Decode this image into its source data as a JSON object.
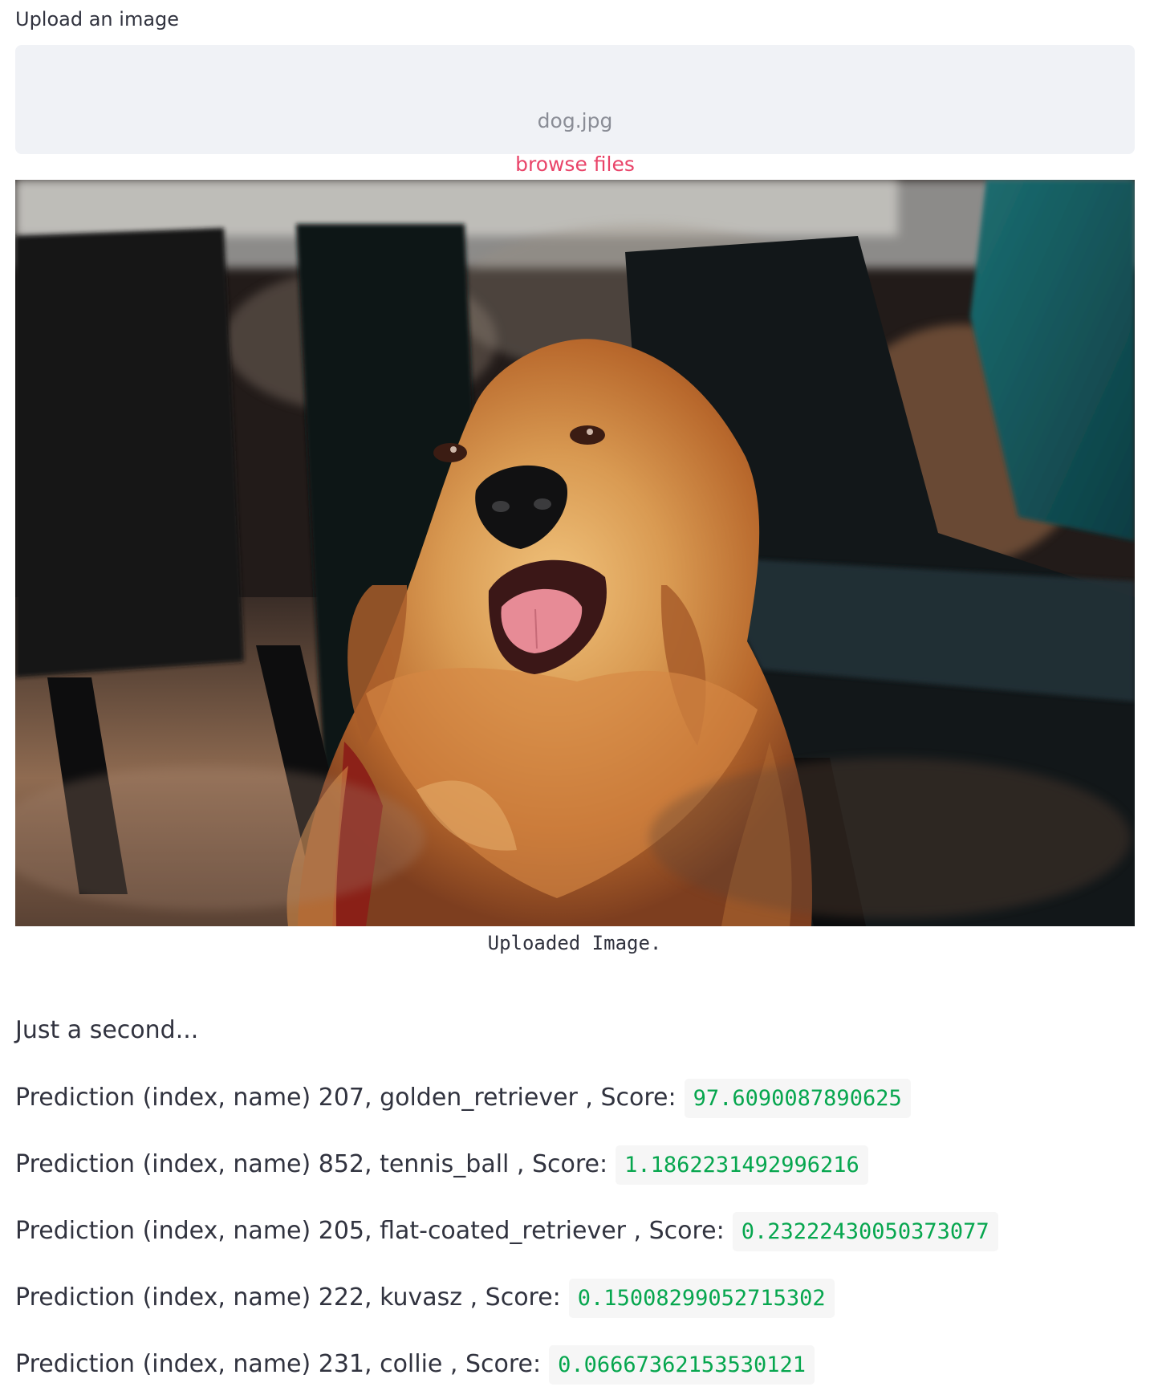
{
  "uploader": {
    "label": "Upload an image",
    "file_name": "dog.jpg",
    "browse_label": "browse files"
  },
  "image": {
    "caption": "Uploaded Image."
  },
  "status": "Just a second...",
  "predictions": [
    {
      "prefix": "Prediction (index, name) 207, golden_retriever , Score:",
      "score": "97.6090087890625"
    },
    {
      "prefix": "Prediction (index, name) 852, tennis_ball , Score:",
      "score": "1.1862231492996216"
    },
    {
      "prefix": "Prediction (index, name) 205, flat-coated_retriever , Score:",
      "score": "0.23222430050373077"
    },
    {
      "prefix": "Prediction (index, name) 222, kuvasz , Score:",
      "score": "0.15008299052715302"
    },
    {
      "prefix": "Prediction (index, name) 231, collie , Score:",
      "score": "0.06667362153530121"
    }
  ],
  "colors": {
    "accent_pink": "#e94469",
    "score_green": "#06a64e",
    "dropzone_background": "#f0f2f6"
  }
}
